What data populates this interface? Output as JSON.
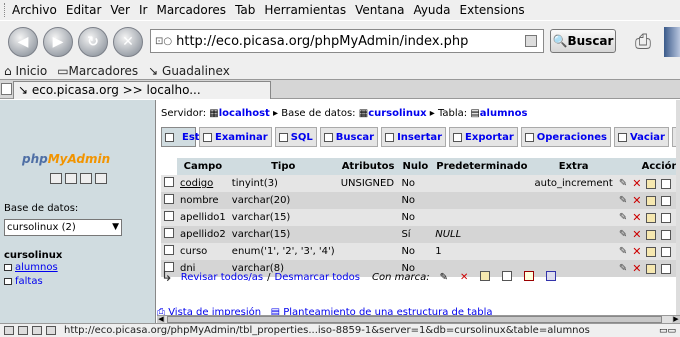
{
  "menubar": {
    "items": [
      "Archivo",
      "Editar",
      "Ver",
      "Ir",
      "Marcadores",
      "Tab",
      "Herramientas",
      "Ventana",
      "Ayuda",
      "Extensions"
    ]
  },
  "navbar": {
    "url": "http://eco.picasa.org/phpMyAdmin/index.php",
    "search_label": "Buscar"
  },
  "bookmarks": {
    "items": [
      "Inicio",
      "Marcadores",
      "Guadalinex"
    ]
  },
  "tab": {
    "title": "eco.picasa.org >> localho..."
  },
  "left": {
    "logo_php": "php",
    "logo_myadmin": "MyAdmin",
    "db_label": "Base de datos:",
    "db_selected": "cursolinux (2)",
    "db_name": "cursolinux",
    "tables": [
      "alumnos",
      "faltas"
    ]
  },
  "breadcrumb": {
    "server_label": "Servidor:",
    "server": "localhost",
    "db_label": "Base de datos:",
    "db": "cursolinux",
    "table_label": "Tabla:",
    "table": "alumnos"
  },
  "tabs": [
    "Estructura",
    "Examinar",
    "SQL",
    "Buscar",
    "Insertar",
    "Exportar",
    "Operaciones",
    "Vaciar"
  ],
  "table": {
    "headers": [
      "Campo",
      "Tipo",
      "Atributos",
      "Nulo",
      "Predeterminado",
      "Extra",
      "Acción"
    ],
    "rows": [
      {
        "campo": "codigo",
        "tipo": "tinyint(3)",
        "atributos": "UNSIGNED",
        "nulo": "No",
        "pred": "",
        "extra": "auto_increment"
      },
      {
        "campo": "nombre",
        "tipo": "varchar(20)",
        "atributos": "",
        "nulo": "No",
        "pred": "",
        "extra": ""
      },
      {
        "campo": "apellido1",
        "tipo": "varchar(15)",
        "atributos": "",
        "nulo": "No",
        "pred": "",
        "extra": ""
      },
      {
        "campo": "apellido2",
        "tipo": "varchar(15)",
        "atributos": "",
        "nulo": "Sí",
        "pred": "NULL",
        "extra": ""
      },
      {
        "campo": "curso",
        "tipo": "enum('1', '2', '3', '4')",
        "atributos": "",
        "nulo": "No",
        "pred": "1",
        "extra": ""
      },
      {
        "campo": "dni",
        "tipo": "varchar(8)",
        "atributos": "",
        "nulo": "No",
        "pred": "",
        "extra": ""
      }
    ]
  },
  "selection": {
    "select_all": "Revisar todos/as",
    "separator": "/",
    "deselect_all": "Desmarcar todos",
    "with_marked": "Con marca:"
  },
  "bottom_links": {
    "print": "Vista de impresión",
    "propose": "Planteamiento de una estructura de tabla"
  },
  "status": {
    "url": "http://eco.picasa.org/phpMyAdmin/tbl_properties...iso-8859-1&server=1&db=cursolinux&table=alumnos"
  }
}
